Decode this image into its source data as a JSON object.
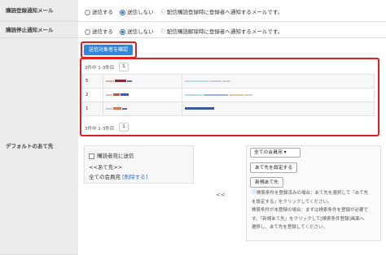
{
  "rows": {
    "purchase_register": {
      "label": "購読登録通知メール",
      "opt_send": "送信する",
      "opt_nosend": "送信しない",
      "info": "配信購読登録時に登録者へ通知するメールです。"
    },
    "purchase_stop": {
      "label": "購読停止通知メール",
      "opt_send": "送信する",
      "opt_nosend": "送信しない",
      "info": "配信購読解除時に登録者へ通知するメールです。"
    },
    "default_dest": {
      "label": "デフォルトのあて先"
    }
  },
  "confirm_button": "送信対象者を確認",
  "pager": {
    "summary": "3件中 1-3件目",
    "page": "1"
  },
  "results": [
    {
      "id": "5"
    },
    {
      "id": "2"
    },
    {
      "id": "1"
    }
  ],
  "dest_panel": {
    "checkbox_label": "購読者宛に送信",
    "heading": "<<あて先>>",
    "member": "全ての会員宛",
    "delete_link": "[削除する]"
  },
  "arrow": "<<",
  "right_panel": {
    "select_value": "全ての会員宛",
    "set_button": "あて先を設定する",
    "new_button": "新規あて先",
    "note": "検索条件を登録済みの場合：あて先を選択して「あて先を設定する」をクリックしてください。検索条件が未登録の場合：まずは検索条件を登録が必要です。「新規あて先」をクリックして[検索条件登録]画面へ遷移し、あて先を登録してください。",
    "note_lines": [
      "検索条件を登録済みの場合：あて先を選択して「あて先",
      "を設定する」をクリックしてください。",
      "検索条件が未登録の場合：まずは検索条件を登録が必要で",
      "す。「新規あて先」をクリックして[検索条件登録]画面へ",
      "遷移し、あて先を登録してください。"
    ]
  },
  "colors": {
    "accent": "#2f86de",
    "highlight": "#e02020",
    "label_bg": "#ececec"
  }
}
